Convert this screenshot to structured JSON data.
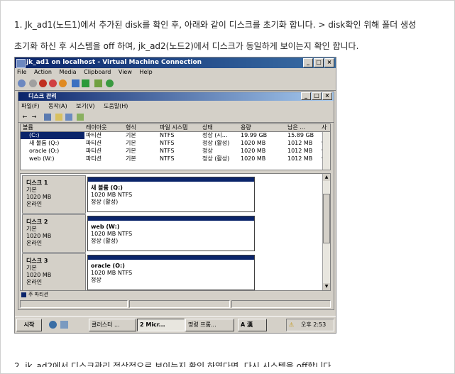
{
  "intro": {
    "line1": "1. Jk_ad1(노드1)에서 추가된 disk를 확인 후, 아래와 같이 디스크를 초기화 합니다. > disk확인 위해 폴더 생성",
    "line2": "초기화 하신 후 시스템을 off 하여, jk_ad2(노드2)에서 디스크가 동일하게 보이는지 확인 합니다."
  },
  "vm": {
    "title": "jk_ad1 on localhost - Virtual Machine Connection",
    "menu": [
      "File",
      "Action",
      "Media",
      "Clipboard",
      "View",
      "Help"
    ]
  },
  "diskmgmt": {
    "title": "디스크 관리",
    "menu": [
      "파일(F)",
      "동작(A)",
      "보기(V)",
      "도움말(H)"
    ],
    "columns": [
      "볼륨",
      "레이아웃",
      "형식",
      "파일 시스템",
      "상태",
      "용량",
      "남은 ...",
      "사"
    ],
    "volumes": [
      [
        "(C:)",
        "파티션",
        "기본",
        "NTFS",
        "정상 (시...",
        "19.99 GB",
        "15.89 GB",
        "79"
      ],
      [
        "새 볼륨 (Q:)",
        "파티션",
        "기본",
        "NTFS",
        "정상 (활성)",
        "1020 MB",
        "1012 MB",
        "9"
      ],
      [
        "oracle (O:)",
        "파티션",
        "기본",
        "NTFS",
        "정상",
        "1020 MB",
        "1012 MB",
        "9"
      ],
      [
        "web (W:)",
        "파티션",
        "기본",
        "NTFS",
        "정상 (활성)",
        "1020 MB",
        "1012 MB",
        "9"
      ]
    ],
    "disks": [
      {
        "name": "디스크 1",
        "type": "기본",
        "size": "1020 MB",
        "state": "온라인",
        "part_name": "새 볼륨 (Q:)",
        "part_size": "1020 MB NTFS",
        "part_state": "정상 (활성)"
      },
      {
        "name": "디스크 2",
        "type": "기본",
        "size": "1020 MB",
        "state": "온라인",
        "part_name": "web (W:)",
        "part_size": "1020 MB NTFS",
        "part_state": "정상 (활성)"
      },
      {
        "name": "디스크 3",
        "type": "기본",
        "size": "1020 MB",
        "state": "온라인",
        "part_name": "oracle (O:)",
        "part_size": "1020 MB NTFS",
        "part_state": "정상"
      }
    ],
    "legend": "주 파티션"
  },
  "taskbar": {
    "start": "시작",
    "tasks": [
      "클러스터 ...",
      "2 Micr...",
      "명령 프롬..."
    ],
    "ime": "A 漢",
    "clock": "오후 2:53"
  },
  "footer_text": "2. jk_ad2에서 디스크관리 정상적으로 보이는지 확인 하였다면, 다시 시스템을 off합니다."
}
